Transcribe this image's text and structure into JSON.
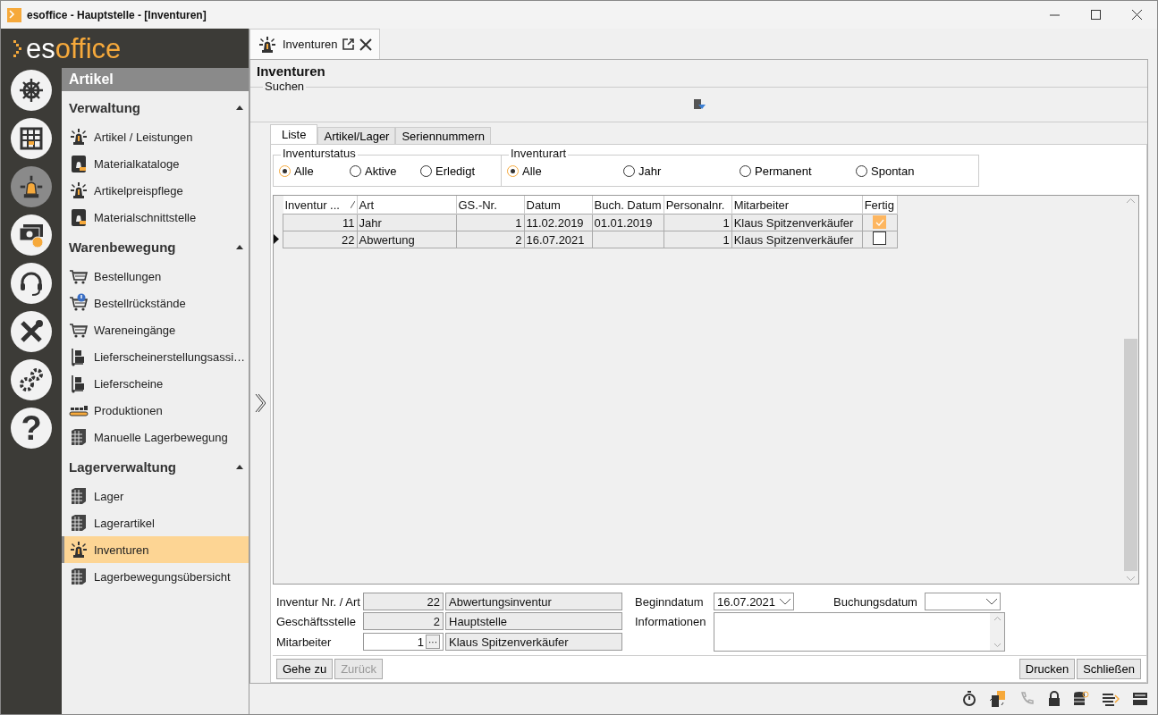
{
  "window": {
    "title": "esoffice - Hauptstelle - [Inventuren]"
  },
  "logo": {
    "part_1": "es",
    "part_2": "office"
  },
  "rail": [
    {
      "selected": false
    },
    {
      "selected": false
    },
    {
      "selected": true
    },
    {
      "selected": false
    },
    {
      "selected": false
    },
    {
      "selected": false
    },
    {
      "selected": false
    },
    {
      "selected": false,
      "glyph": "?"
    }
  ],
  "sidebar": {
    "header": "Artikel",
    "sections": [
      {
        "title": "Verwaltung",
        "expanded": true,
        "items": [
          {
            "label": "Artikel / Leistungen",
            "selected": false
          },
          {
            "label": "Materialkataloge",
            "selected": false
          },
          {
            "label": "Artikelpreispflege",
            "selected": false
          },
          {
            "label": "Materialschnittstelle",
            "selected": false
          }
        ]
      },
      {
        "title": "Warenbewegung",
        "expanded": true,
        "items": [
          {
            "label": "Bestellungen",
            "selected": false
          },
          {
            "label": "Bestellrückstände",
            "selected": false
          },
          {
            "label": "Wareneingänge",
            "selected": false
          },
          {
            "label": "Lieferscheinerstellungsassi…",
            "selected": false
          },
          {
            "label": "Lieferscheine",
            "selected": false
          },
          {
            "label": "Produktionen",
            "selected": false
          },
          {
            "label": "Manuelle Lagerbewegung",
            "selected": false
          }
        ]
      },
      {
        "title": "Lagerverwaltung",
        "expanded": true,
        "items": [
          {
            "label": "Lager",
            "selected": false
          },
          {
            "label": "Lagerartikel",
            "selected": false
          },
          {
            "label": "Inventuren",
            "selected": true
          },
          {
            "label": "Lagerbewegungsübersicht",
            "selected": false
          }
        ]
      }
    ]
  },
  "doc_tabs": [
    {
      "label": "Inventuren",
      "selected": true
    }
  ],
  "page": {
    "title": "Inventuren",
    "search_group": "Suchen"
  },
  "sub_tabs": [
    {
      "label": "Liste",
      "selected": true
    },
    {
      "label": "Artikel/Lager",
      "selected": false
    },
    {
      "label": "Seriennummern",
      "selected": false
    }
  ],
  "filters": [
    {
      "title": "Inventurstatus",
      "options": [
        {
          "label": "Alle",
          "selected": true
        },
        {
          "label": "Aktive",
          "selected": false
        },
        {
          "label": "Erledigt",
          "selected": false
        }
      ]
    },
    {
      "title": "Inventurart",
      "options": [
        {
          "label": "Alle",
          "selected": true
        },
        {
          "label": "Jahr",
          "selected": false
        },
        {
          "label": "Permanent",
          "selected": false
        },
        {
          "label": "Spontan",
          "selected": false
        }
      ]
    }
  ],
  "table": {
    "columns": [
      {
        "label": "Inventur ...",
        "sorted": true
      },
      {
        "label": "Art",
        "sorted": false
      },
      {
        "label": "GS.-Nr.",
        "sorted": false
      },
      {
        "label": "Datum",
        "sorted": false
      },
      {
        "label": "Buch. Datum",
        "sorted": false
      },
      {
        "label": "Personalnr.",
        "sorted": false
      },
      {
        "label": "Mitarbeiter",
        "sorted": false
      },
      {
        "label": "Fertig",
        "sorted": false
      }
    ],
    "rows": [
      {
        "current": false,
        "cells": [
          "11",
          "Jahr",
          "1",
          "11.02.2019",
          "01.01.2019",
          "1",
          "Klaus Spitzenverkäufer"
        ],
        "done": true
      },
      {
        "current": true,
        "cells": [
          "22",
          "Abwertung",
          "2",
          "16.07.2021",
          "",
          "1",
          "Klaus Spitzenverkäufer"
        ],
        "done": false
      }
    ]
  },
  "form": {
    "inventur_label": "Inventur Nr. / Art",
    "inventur_nr": "22",
    "inventur_art": "Abwertungsinventur",
    "branch_label": "Geschäftsstelle",
    "branch_nr": "2",
    "branch_name": "Hauptstelle",
    "employee_label": "Mitarbeiter",
    "employee_nr": "1",
    "employee_button": "···",
    "employee_name": "Klaus Spitzenverkäufer",
    "begin_label": "Beginndatum",
    "begin_value": "16.07.2021",
    "booking_label": "Buchungsdatum",
    "info_label": "Informationen"
  },
  "buttons": [
    {
      "label": "Gehe zu",
      "disabled": false
    },
    {
      "label": "Zurück",
      "disabled": true
    }
  ],
  "right_buttons": [
    {
      "label": "Drucken",
      "disabled": false
    },
    {
      "label": "Schließen",
      "disabled": false
    }
  ]
}
